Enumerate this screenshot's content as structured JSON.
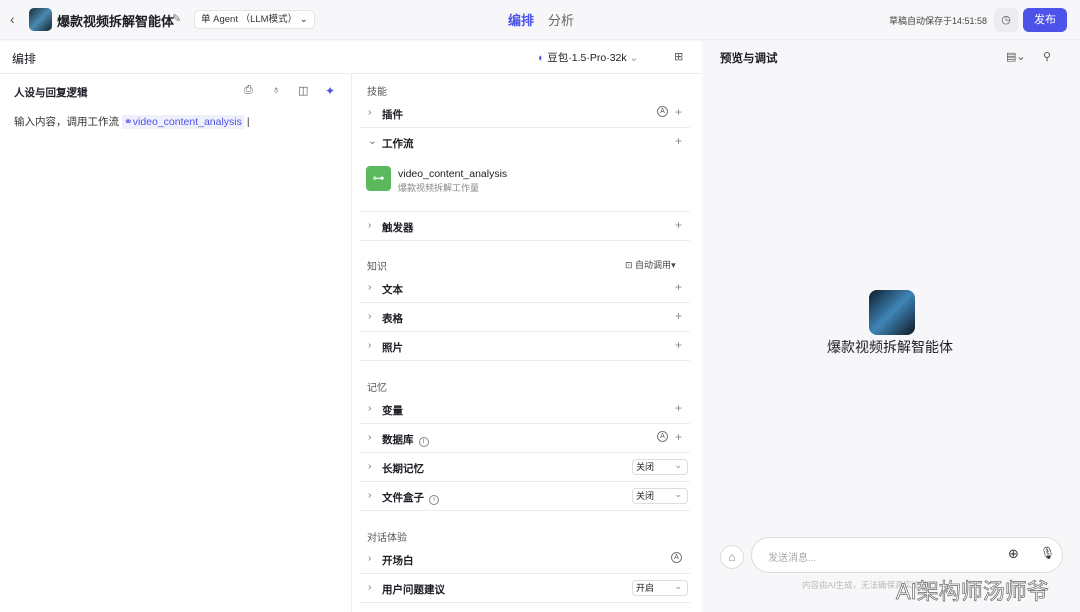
{
  "header": {
    "back": "‹",
    "title": "爆款视频拆解智能体",
    "mode": "单 Agent （LLM模式）",
    "tabs": [
      "编排",
      "分析"
    ],
    "saved": "草稿自动保存于14:51:58",
    "publish": "发布"
  },
  "compose": {
    "title": "编排",
    "model": "豆包·1.5·Pro·32k"
  },
  "persona": {
    "title": "人设与回复逻辑",
    "text": "输入内容，调用工作流",
    "workflow_ref": "video_content_analysis"
  },
  "skills": {
    "title": "技能",
    "plugin": "插件",
    "workflow": "工作流",
    "workflow_item": {
      "name": "video_content_analysis",
      "desc": "爆款视频拆解工作量"
    },
    "trigger": "触发器"
  },
  "knowledge": {
    "title": "知识",
    "auto": "自动调用",
    "items": [
      "文本",
      "表格",
      "照片"
    ]
  },
  "memory": {
    "title": "记忆",
    "variable": "变量",
    "database": "数据库",
    "longterm": "长期记忆",
    "longterm_value": "关闭",
    "filebox": "文件盒子",
    "filebox_value": "关闭"
  },
  "dialog": {
    "title": "对话体验",
    "opening": "开场白",
    "suggest": "用户问题建议",
    "suggest_value": "开启"
  },
  "preview": {
    "title": "预览与调试",
    "agent_name": "爆款视频拆解智能体",
    "placeholder": "发送消息...",
    "disclaimer": "内容由AI生成，无法确保真实准确"
  },
  "watermark": "AI架构师汤师爷",
  "colors": {
    "accent": "#4d53e8",
    "workflow_green": "#5cb85c"
  }
}
